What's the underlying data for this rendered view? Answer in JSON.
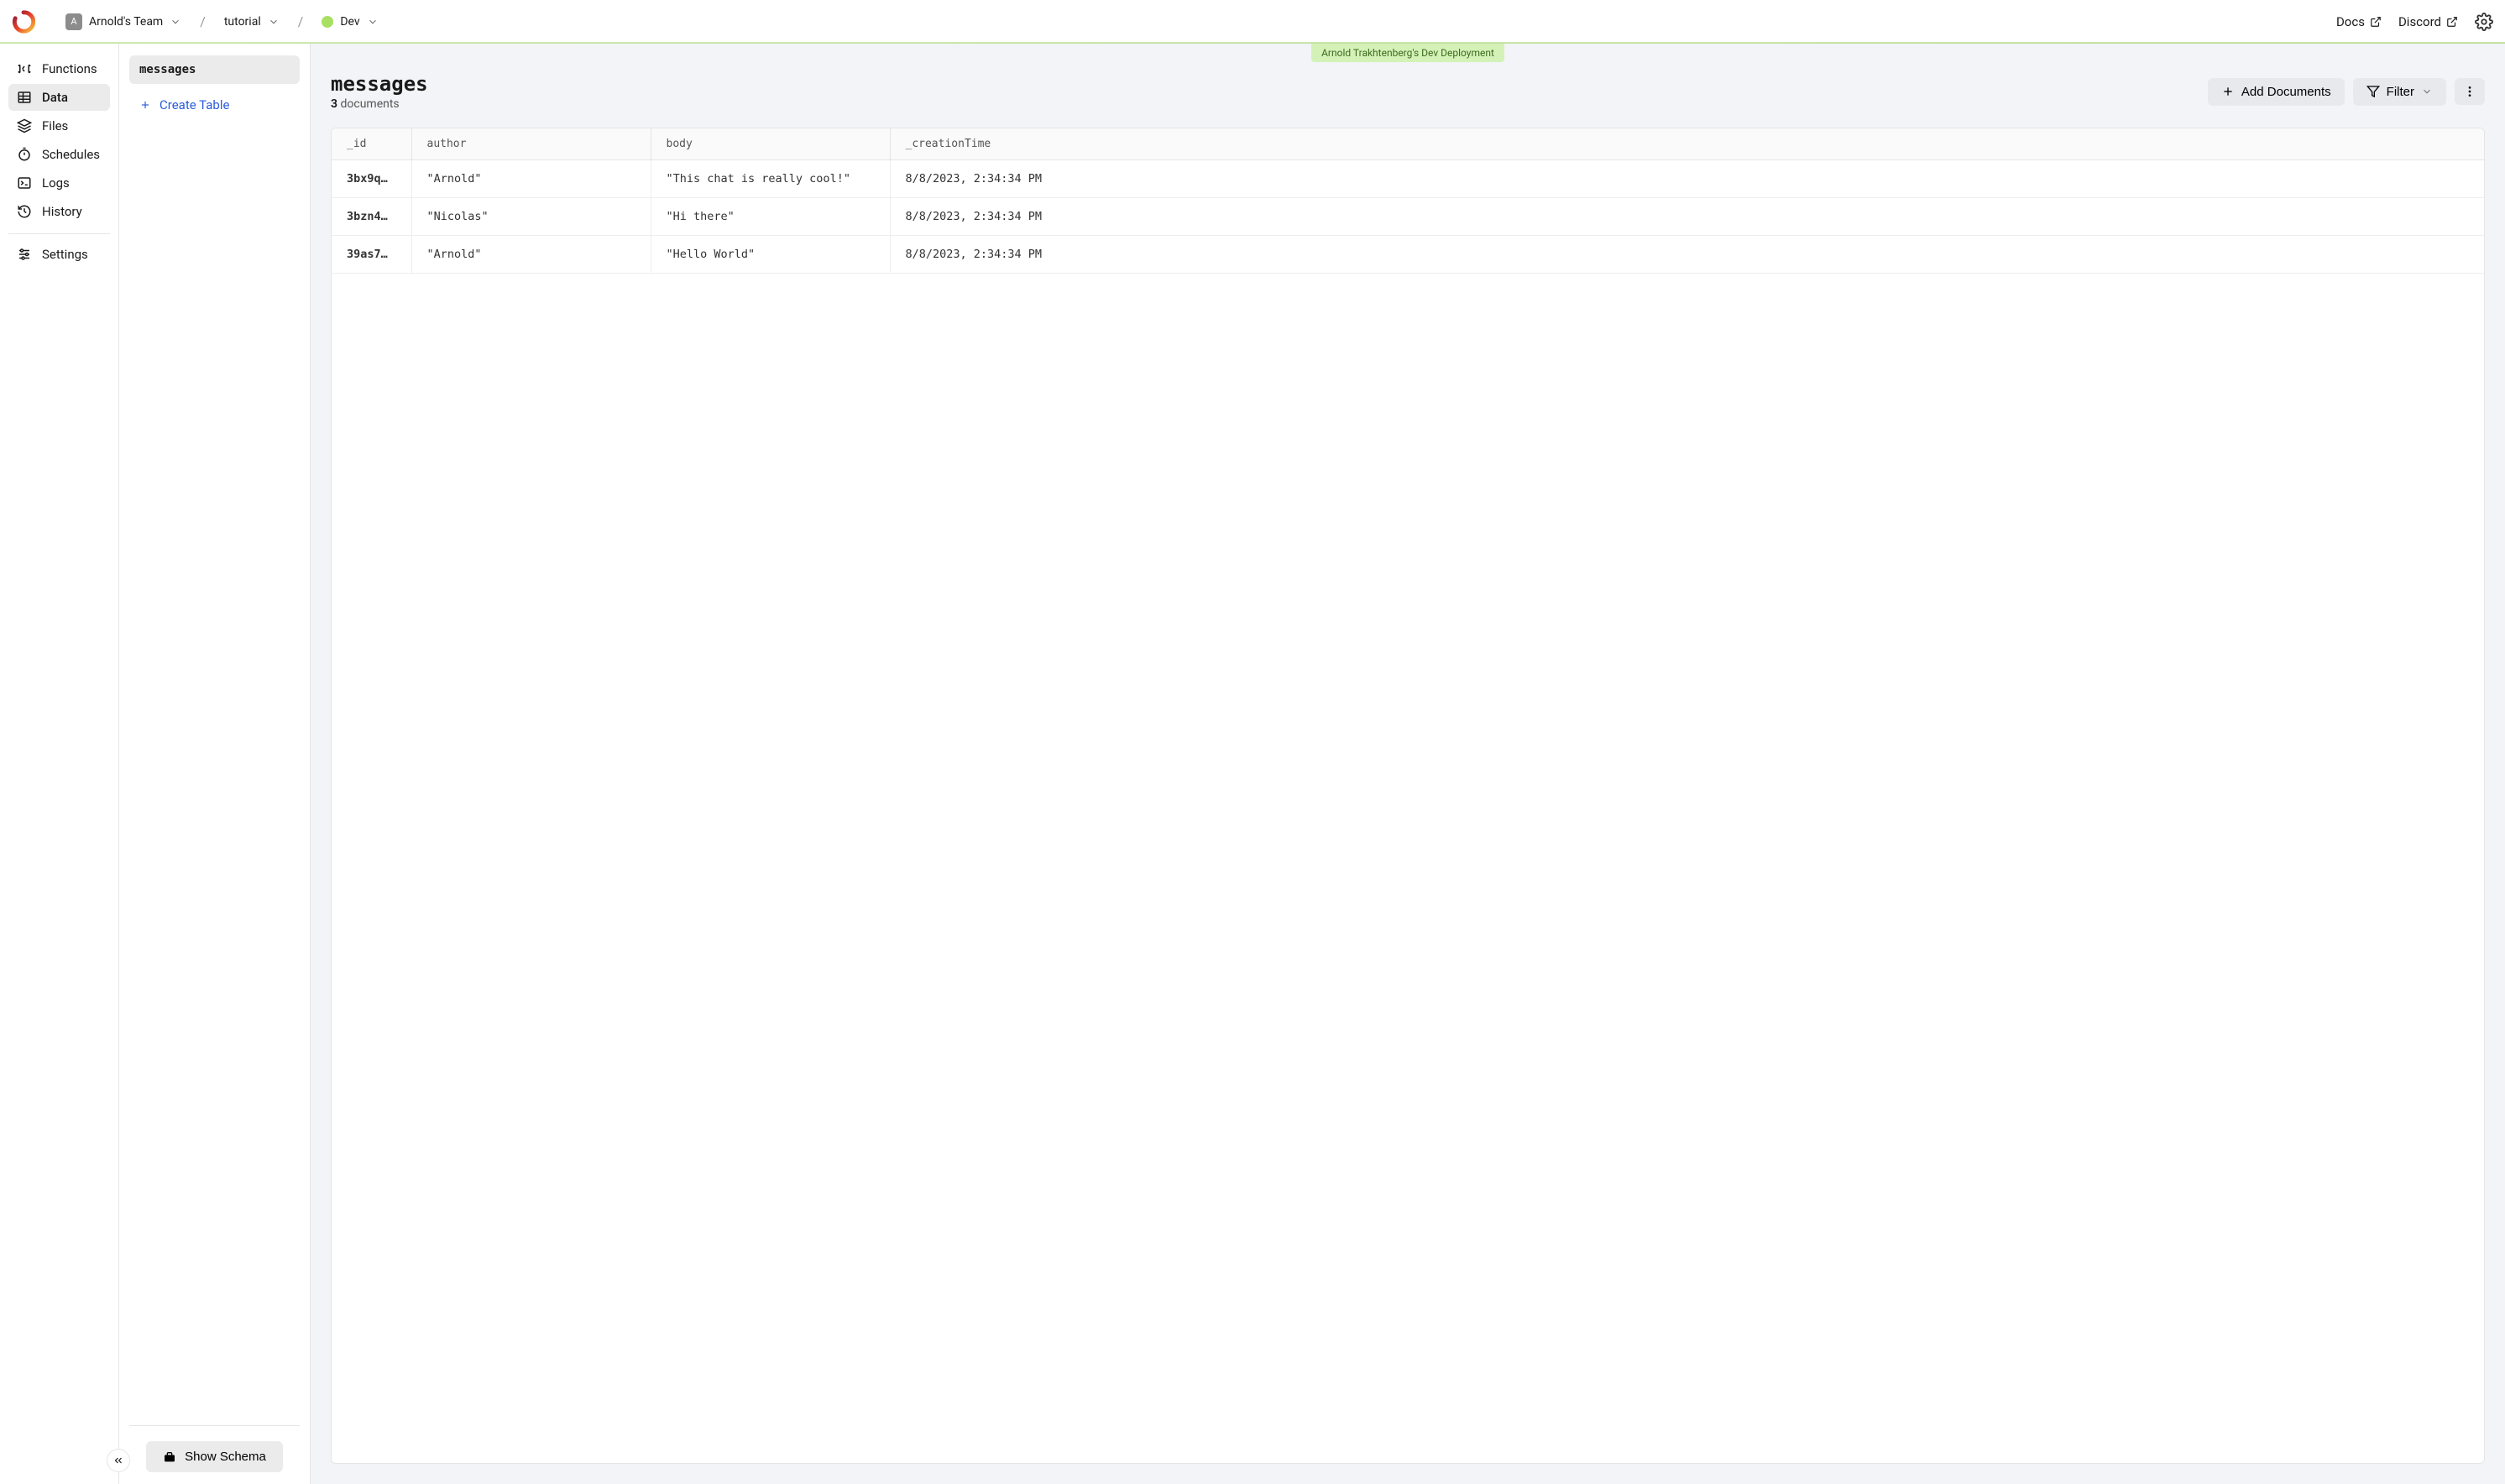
{
  "breadcrumb": {
    "team_initial": "A",
    "team": "Arnold's Team",
    "project": "tutorial",
    "environment": "Dev"
  },
  "topbar": {
    "docs": "Docs",
    "discord": "Discord"
  },
  "sidebar": {
    "items": [
      {
        "label": "Functions"
      },
      {
        "label": "Data"
      },
      {
        "label": "Files"
      },
      {
        "label": "Schedules"
      },
      {
        "label": "Logs"
      },
      {
        "label": "History"
      }
    ],
    "settings": "Settings"
  },
  "tables": {
    "items": [
      {
        "name": "messages"
      }
    ],
    "create_label": "Create Table",
    "show_schema_label": "Show Schema"
  },
  "deployment_badge": "Arnold Trakhtenberg's Dev Deployment",
  "content": {
    "title": "messages",
    "count": "3",
    "count_label": "documents",
    "add_documents": "Add Documents",
    "filter": "Filter"
  },
  "table": {
    "columns": [
      "_id",
      "author",
      "body",
      "_creationTime"
    ],
    "rows": [
      {
        "id": "3bx9q…",
        "author": "\"Arnold\"",
        "body": "\"This chat is really cool!\"",
        "creation": "8/8/2023, 2:34:34 PM"
      },
      {
        "id": "3bzn4…",
        "author": "\"Nicolas\"",
        "body": "\"Hi there\"",
        "creation": "8/8/2023, 2:34:34 PM"
      },
      {
        "id": "39as7…",
        "author": "\"Arnold\"",
        "body": "\"Hello World\"",
        "creation": "8/8/2023, 2:34:34 PM"
      }
    ]
  }
}
